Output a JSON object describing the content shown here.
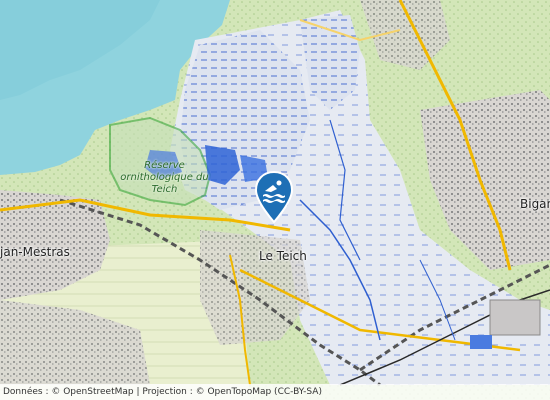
{
  "map": {
    "places": {
      "town_left": "jan-Mestras",
      "town_center": "Le Teich",
      "town_right": "Bigan"
    },
    "reserve": {
      "line1": "Réserve",
      "line2": "ornithologique du",
      "line3": "Teich"
    },
    "marker": {
      "icon": "swimming-icon",
      "color": "#1e6fb5"
    },
    "attribution": "Données : © OpenStreetMap | Projection : © OpenTopoMap (CC-BY-SA)",
    "colors": {
      "sea": "#8fd3de",
      "land": "#e4ead8",
      "forest": "#cfe3b4",
      "wetland": "#3a6fe0",
      "road_main": "#f0b800",
      "urban": "#c8c8c8",
      "reserve_edge": "#3aa63a"
    }
  }
}
